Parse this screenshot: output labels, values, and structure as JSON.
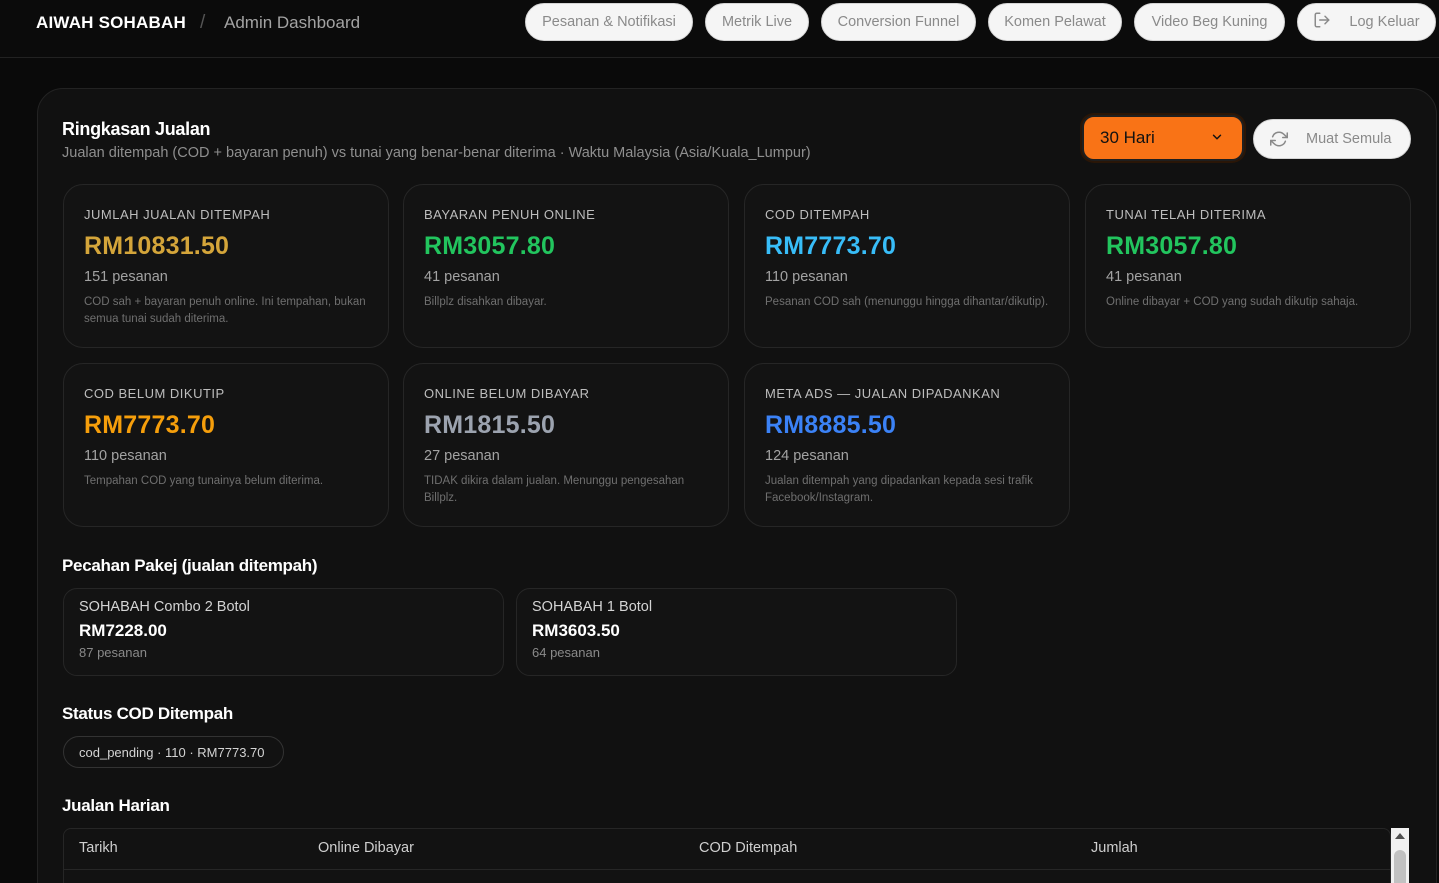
{
  "header": {
    "brand": "AIWAH SOHABAH",
    "separator": "/",
    "page": "Admin Dashboard",
    "nav": [
      {
        "label": "Pesanan & Notifikasi"
      },
      {
        "label": "Metrik Live"
      },
      {
        "label": "Conversion Funnel"
      },
      {
        "label": "Komen Pelawat"
      },
      {
        "label": "Video Beg Kuning"
      },
      {
        "label": "Log Keluar",
        "icon": "logout-icon"
      }
    ]
  },
  "summary": {
    "title": "Ringkasan Jualan",
    "subtitle": "Jualan ditempah (COD + bayaran penuh) vs tunai yang benar-benar diterima · Waktu Malaysia (Asia/Kuala_Lumpur)",
    "range": "30 Hari",
    "reload": "Muat Semula",
    "cards": [
      {
        "label": "JUMLAH JUALAN DITEMPAH",
        "value": "RM10831.50",
        "count": "151 pesanan",
        "note": "COD sah + bayaran penuh online. Ini tempahan, bukan semua tunai sudah diterima.",
        "color": "#d4a53a"
      },
      {
        "label": "BAYARAN PENUH ONLINE",
        "value": "RM3057.80",
        "count": "41 pesanan",
        "note": "Billplz disahkan dibayar.",
        "color": "#22c55e"
      },
      {
        "label": "COD DITEMPAH",
        "value": "RM7773.70",
        "count": "110 pesanan",
        "note": "Pesanan COD sah (menunggu hingga dihantar/dikutip).",
        "color": "#38bdf8"
      },
      {
        "label": "TUNAI TELAH DITERIMA",
        "value": "RM3057.80",
        "count": "41 pesanan",
        "note": "Online dibayar + COD yang sudah dikutip sahaja.",
        "color": "#22c55e"
      },
      {
        "label": "COD BELUM DIKUTIP",
        "value": "RM7773.70",
        "count": "110 pesanan",
        "note": "Tempahan COD yang tunainya belum diterima.",
        "color": "#f59e0b"
      },
      {
        "label": "ONLINE BELUM DIBAYAR",
        "value": "RM1815.50",
        "count": "27 pesanan",
        "note": "TIDAK dikira dalam jualan. Menunggu pengesahan Billplz.",
        "color": "#9ca3af"
      },
      {
        "label": "META ADS — JUALAN DIPADANKAN",
        "value": "RM8885.50",
        "count": "124 pesanan",
        "note": "Jualan ditempah yang dipadankan kepada sesi trafik Facebook/Instagram.",
        "color": "#3b82f6"
      }
    ]
  },
  "packages": {
    "title": "Pecahan Pakej (jualan ditempah)",
    "items": [
      {
        "name": "SOHABAH Combo 2 Botol",
        "price": "RM7228.00",
        "count": "87 pesanan"
      },
      {
        "name": "SOHABAH 1 Botol",
        "price": "RM3603.50",
        "count": "64 pesanan"
      }
    ]
  },
  "cod_status": {
    "title": "Status COD Ditempah",
    "chip": "cod_pending · 110 · RM7773.70"
  },
  "daily": {
    "title": "Jualan Harian",
    "columns": [
      "Tarikh",
      "Online Dibayar",
      "COD Ditempah",
      "Jumlah"
    ]
  }
}
